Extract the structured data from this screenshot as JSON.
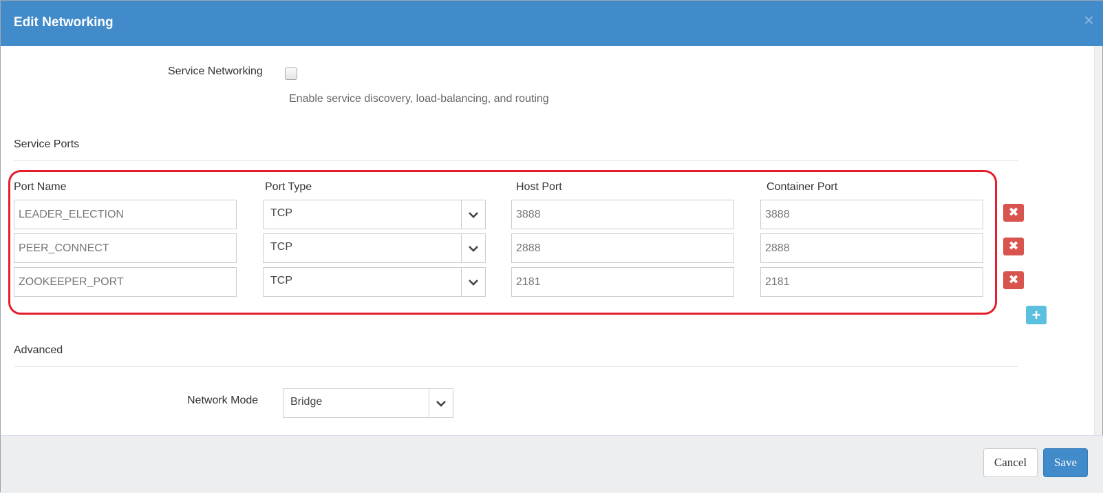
{
  "dialog": {
    "title": "Edit Networking",
    "close_glyph": "×"
  },
  "service_networking": {
    "label": "Service Networking",
    "checked": false,
    "help": "Enable service discovery, load-balancing, and routing"
  },
  "service_ports": {
    "section_title": "Service Ports",
    "columns": [
      "Port Name",
      "Port Type",
      "Host Port",
      "Container Port"
    ],
    "rows": [
      {
        "name": "LEADER_ELECTION",
        "type": "TCP",
        "host_port": "3888",
        "container_port": "3888"
      },
      {
        "name": "PEER_CONNECT",
        "type": "TCP",
        "host_port": "2888",
        "container_port": "2888"
      },
      {
        "name": "ZOOKEEPER_PORT",
        "type": "TCP",
        "host_port": "2181",
        "container_port": "2181"
      }
    ],
    "remove_glyph": "✖",
    "add_glyph": "+"
  },
  "advanced": {
    "section_title": "Advanced",
    "network_mode_label": "Network Mode",
    "network_mode_value": "Bridge"
  },
  "footer": {
    "cancel_label": "Cancel",
    "save_label": "Save"
  },
  "colors": {
    "header": "#428bca",
    "highlight": "#e41e2b",
    "danger": "#d9534f",
    "info": "#5bc0de"
  },
  "icons": {
    "close": "close-icon",
    "dropdown": "chevron-down-icon",
    "remove": "remove-icon",
    "add": "plus-icon"
  }
}
